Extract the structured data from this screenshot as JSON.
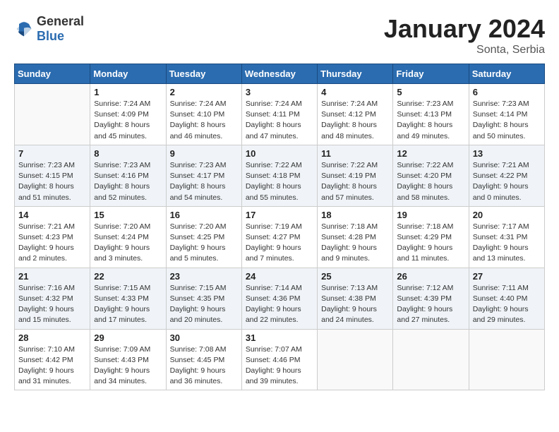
{
  "header": {
    "logo_general": "General",
    "logo_blue": "Blue",
    "month_title": "January 2024",
    "location": "Sonta, Serbia"
  },
  "weekdays": [
    "Sunday",
    "Monday",
    "Tuesday",
    "Wednesday",
    "Thursday",
    "Friday",
    "Saturday"
  ],
  "weeks": [
    [
      {
        "day": "",
        "sunrise": "",
        "sunset": "",
        "daylight": "",
        "empty": true
      },
      {
        "day": "1",
        "sunrise": "Sunrise: 7:24 AM",
        "sunset": "Sunset: 4:09 PM",
        "daylight": "Daylight: 8 hours and 45 minutes."
      },
      {
        "day": "2",
        "sunrise": "Sunrise: 7:24 AM",
        "sunset": "Sunset: 4:10 PM",
        "daylight": "Daylight: 8 hours and 46 minutes."
      },
      {
        "day": "3",
        "sunrise": "Sunrise: 7:24 AM",
        "sunset": "Sunset: 4:11 PM",
        "daylight": "Daylight: 8 hours and 47 minutes."
      },
      {
        "day": "4",
        "sunrise": "Sunrise: 7:24 AM",
        "sunset": "Sunset: 4:12 PM",
        "daylight": "Daylight: 8 hours and 48 minutes."
      },
      {
        "day": "5",
        "sunrise": "Sunrise: 7:23 AM",
        "sunset": "Sunset: 4:13 PM",
        "daylight": "Daylight: 8 hours and 49 minutes."
      },
      {
        "day": "6",
        "sunrise": "Sunrise: 7:23 AM",
        "sunset": "Sunset: 4:14 PM",
        "daylight": "Daylight: 8 hours and 50 minutes."
      }
    ],
    [
      {
        "day": "7",
        "sunrise": "Sunrise: 7:23 AM",
        "sunset": "Sunset: 4:15 PM",
        "daylight": "Daylight: 8 hours and 51 minutes."
      },
      {
        "day": "8",
        "sunrise": "Sunrise: 7:23 AM",
        "sunset": "Sunset: 4:16 PM",
        "daylight": "Daylight: 8 hours and 52 minutes."
      },
      {
        "day": "9",
        "sunrise": "Sunrise: 7:23 AM",
        "sunset": "Sunset: 4:17 PM",
        "daylight": "Daylight: 8 hours and 54 minutes."
      },
      {
        "day": "10",
        "sunrise": "Sunrise: 7:22 AM",
        "sunset": "Sunset: 4:18 PM",
        "daylight": "Daylight: 8 hours and 55 minutes."
      },
      {
        "day": "11",
        "sunrise": "Sunrise: 7:22 AM",
        "sunset": "Sunset: 4:19 PM",
        "daylight": "Daylight: 8 hours and 57 minutes."
      },
      {
        "day": "12",
        "sunrise": "Sunrise: 7:22 AM",
        "sunset": "Sunset: 4:20 PM",
        "daylight": "Daylight: 8 hours and 58 minutes."
      },
      {
        "day": "13",
        "sunrise": "Sunrise: 7:21 AM",
        "sunset": "Sunset: 4:22 PM",
        "daylight": "Daylight: 9 hours and 0 minutes."
      }
    ],
    [
      {
        "day": "14",
        "sunrise": "Sunrise: 7:21 AM",
        "sunset": "Sunset: 4:23 PM",
        "daylight": "Daylight: 9 hours and 2 minutes."
      },
      {
        "day": "15",
        "sunrise": "Sunrise: 7:20 AM",
        "sunset": "Sunset: 4:24 PM",
        "daylight": "Daylight: 9 hours and 3 minutes."
      },
      {
        "day": "16",
        "sunrise": "Sunrise: 7:20 AM",
        "sunset": "Sunset: 4:25 PM",
        "daylight": "Daylight: 9 hours and 5 minutes."
      },
      {
        "day": "17",
        "sunrise": "Sunrise: 7:19 AM",
        "sunset": "Sunset: 4:27 PM",
        "daylight": "Daylight: 9 hours and 7 minutes."
      },
      {
        "day": "18",
        "sunrise": "Sunrise: 7:18 AM",
        "sunset": "Sunset: 4:28 PM",
        "daylight": "Daylight: 9 hours and 9 minutes."
      },
      {
        "day": "19",
        "sunrise": "Sunrise: 7:18 AM",
        "sunset": "Sunset: 4:29 PM",
        "daylight": "Daylight: 9 hours and 11 minutes."
      },
      {
        "day": "20",
        "sunrise": "Sunrise: 7:17 AM",
        "sunset": "Sunset: 4:31 PM",
        "daylight": "Daylight: 9 hours and 13 minutes."
      }
    ],
    [
      {
        "day": "21",
        "sunrise": "Sunrise: 7:16 AM",
        "sunset": "Sunset: 4:32 PM",
        "daylight": "Daylight: 9 hours and 15 minutes."
      },
      {
        "day": "22",
        "sunrise": "Sunrise: 7:15 AM",
        "sunset": "Sunset: 4:33 PM",
        "daylight": "Daylight: 9 hours and 17 minutes."
      },
      {
        "day": "23",
        "sunrise": "Sunrise: 7:15 AM",
        "sunset": "Sunset: 4:35 PM",
        "daylight": "Daylight: 9 hours and 20 minutes."
      },
      {
        "day": "24",
        "sunrise": "Sunrise: 7:14 AM",
        "sunset": "Sunset: 4:36 PM",
        "daylight": "Daylight: 9 hours and 22 minutes."
      },
      {
        "day": "25",
        "sunrise": "Sunrise: 7:13 AM",
        "sunset": "Sunset: 4:38 PM",
        "daylight": "Daylight: 9 hours and 24 minutes."
      },
      {
        "day": "26",
        "sunrise": "Sunrise: 7:12 AM",
        "sunset": "Sunset: 4:39 PM",
        "daylight": "Daylight: 9 hours and 27 minutes."
      },
      {
        "day": "27",
        "sunrise": "Sunrise: 7:11 AM",
        "sunset": "Sunset: 4:40 PM",
        "daylight": "Daylight: 9 hours and 29 minutes."
      }
    ],
    [
      {
        "day": "28",
        "sunrise": "Sunrise: 7:10 AM",
        "sunset": "Sunset: 4:42 PM",
        "daylight": "Daylight: 9 hours and 31 minutes."
      },
      {
        "day": "29",
        "sunrise": "Sunrise: 7:09 AM",
        "sunset": "Sunset: 4:43 PM",
        "daylight": "Daylight: 9 hours and 34 minutes."
      },
      {
        "day": "30",
        "sunrise": "Sunrise: 7:08 AM",
        "sunset": "Sunset: 4:45 PM",
        "daylight": "Daylight: 9 hours and 36 minutes."
      },
      {
        "day": "31",
        "sunrise": "Sunrise: 7:07 AM",
        "sunset": "Sunset: 4:46 PM",
        "daylight": "Daylight: 9 hours and 39 minutes."
      },
      {
        "day": "",
        "sunrise": "",
        "sunset": "",
        "daylight": "",
        "empty": true
      },
      {
        "day": "",
        "sunrise": "",
        "sunset": "",
        "daylight": "",
        "empty": true
      },
      {
        "day": "",
        "sunrise": "",
        "sunset": "",
        "daylight": "",
        "empty": true
      }
    ]
  ]
}
